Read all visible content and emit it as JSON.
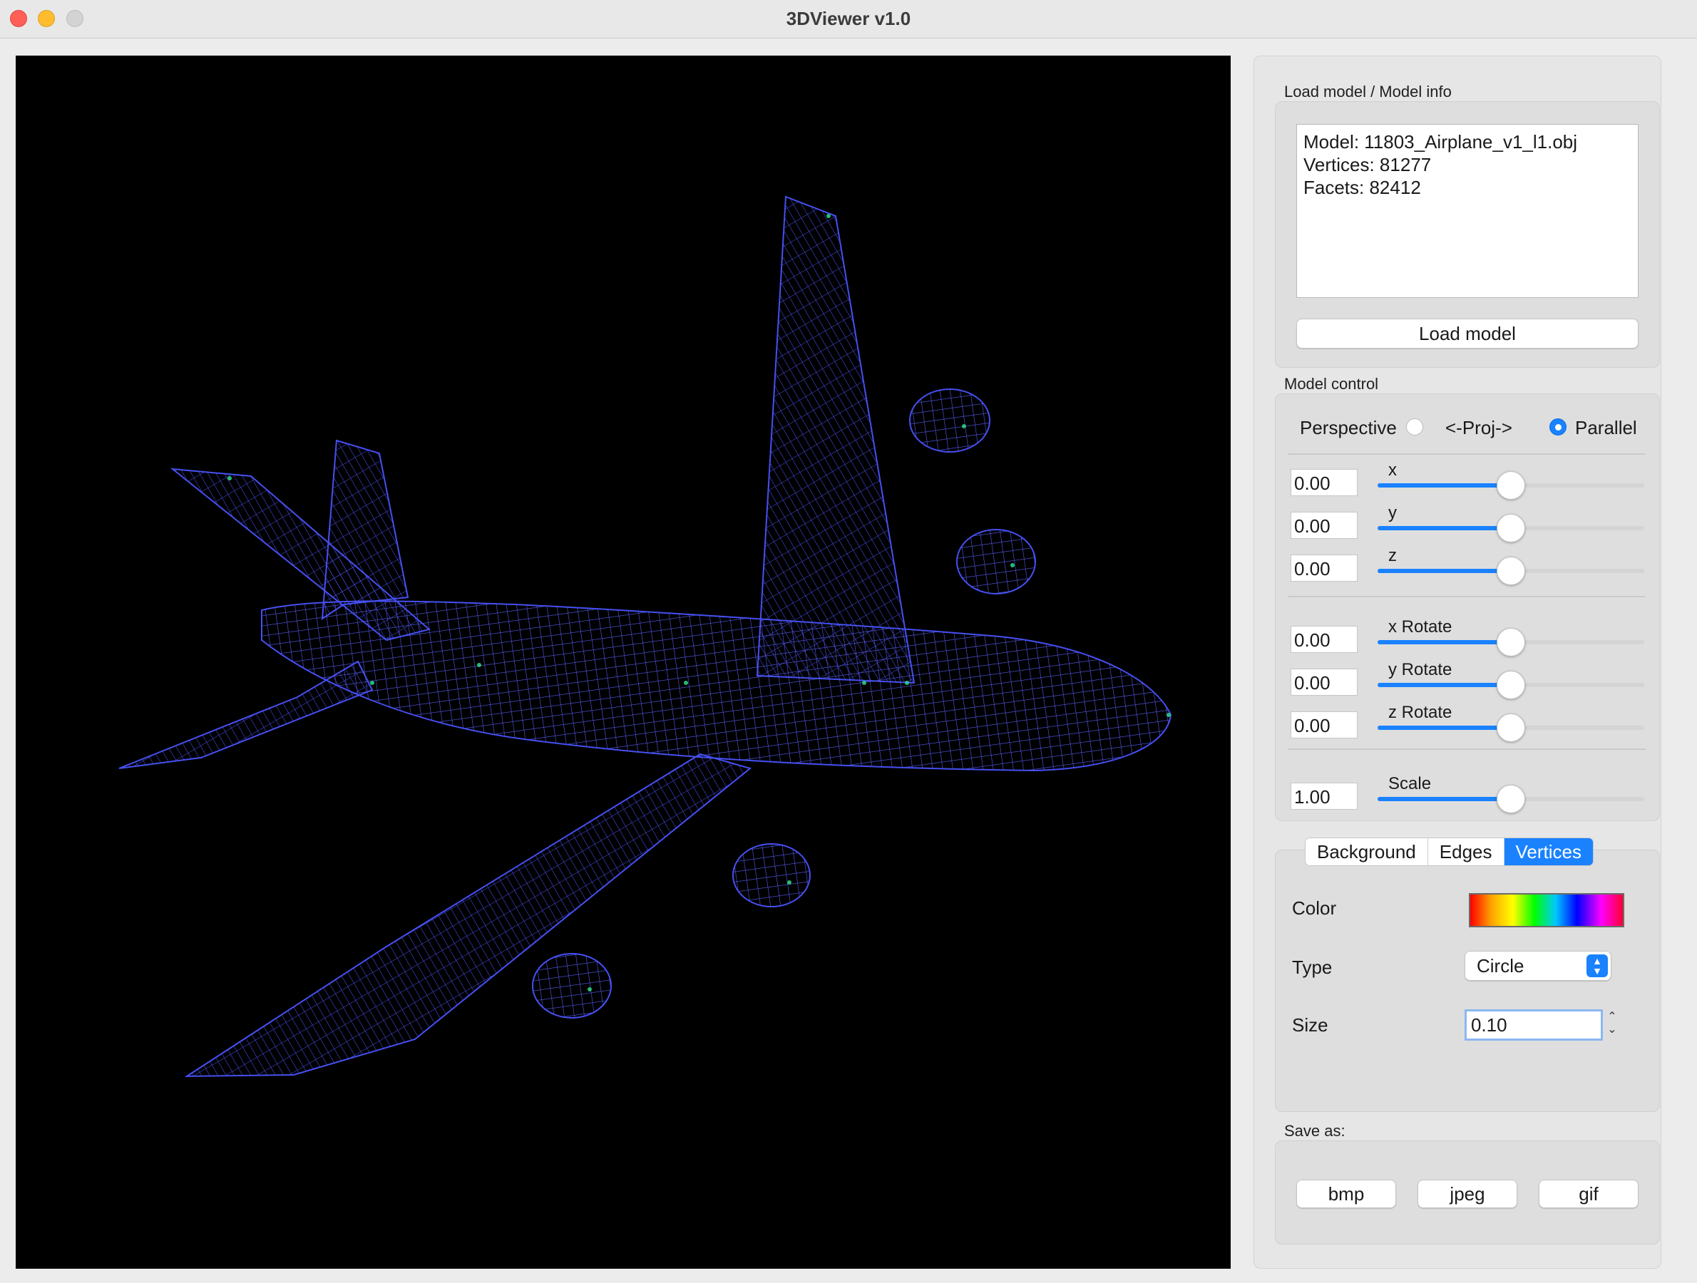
{
  "window": {
    "title": "3DViewer v1.0"
  },
  "load_section": {
    "label": "Load model / Model info",
    "model_line": "Model: 11803_Airplane_v1_l1.obj",
    "vertices_line": "Vertices: 81277",
    "facets_line": "Facets: 82412",
    "load_button": "Load model"
  },
  "control_section": {
    "label": "Model control",
    "projection": {
      "left": "Perspective",
      "middle": "<-Proj->",
      "right": "Parallel",
      "selected": "Parallel"
    },
    "sliders": [
      {
        "label": "x",
        "value": "0.00",
        "fraction": 0.5
      },
      {
        "label": "y",
        "value": "0.00",
        "fraction": 0.5
      },
      {
        "label": "z",
        "value": "0.00",
        "fraction": 0.5
      },
      {
        "label": "x Rotate",
        "value": "0.00",
        "fraction": 0.5
      },
      {
        "label": "y Rotate",
        "value": "0.00",
        "fraction": 0.5
      },
      {
        "label": "z Rotate",
        "value": "0.00",
        "fraction": 0.5
      },
      {
        "label": "Scale",
        "value": "1.00",
        "fraction": 0.5
      }
    ]
  },
  "tabs": {
    "items": [
      "Background",
      "Edges",
      "Vertices"
    ],
    "active": "Vertices"
  },
  "vertices_tab": {
    "color_label": "Color",
    "type_label": "Type",
    "type_value": "Circle",
    "size_label": "Size",
    "size_value": "0.10"
  },
  "save_section": {
    "label": "Save as:",
    "buttons": [
      "bmp",
      "jpeg",
      "gif"
    ]
  },
  "colors": {
    "wireframe": "#4a55ff",
    "vertex_highlight": "#2ddc8a",
    "accent": "#1a82ff",
    "viewport_bg": "#000000"
  }
}
